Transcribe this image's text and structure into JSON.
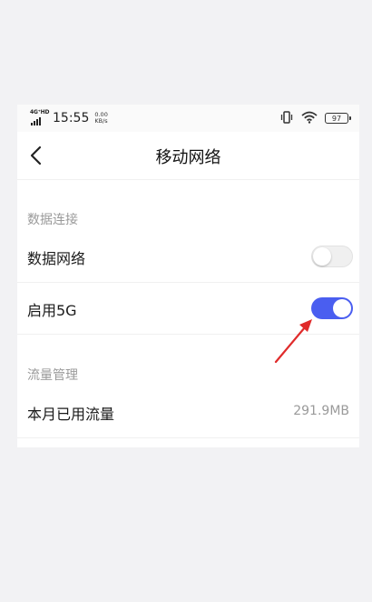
{
  "status_bar": {
    "network_type": "4G⁺HD",
    "time": "15:55",
    "speed_value": "0.00",
    "speed_unit": "KB/s",
    "battery": "97",
    "icons": [
      "signal-icon",
      "vibrate-icon",
      "wifi-icon",
      "battery-icon"
    ]
  },
  "header": {
    "title": "移动网络",
    "back_icon": "chevron-left-icon"
  },
  "sections": {
    "data_connection": {
      "label": "数据连接",
      "rows": {
        "data_network": {
          "label": "数据网络",
          "enabled": false
        },
        "enable_5g": {
          "label": "启用5G",
          "enabled": true
        }
      }
    },
    "traffic_management": {
      "label": "流量管理",
      "rows": {
        "monthly_usage": {
          "label": "本月已用流量",
          "value": "291.9MB"
        }
      }
    }
  },
  "annotation": {
    "icon": "arrow-icon",
    "color": "#e02b2b"
  },
  "colors": {
    "toggle_on": "#4a5ef0",
    "toggle_off": "#f0f0f0",
    "annotation_arrow": "#e02b2b"
  }
}
